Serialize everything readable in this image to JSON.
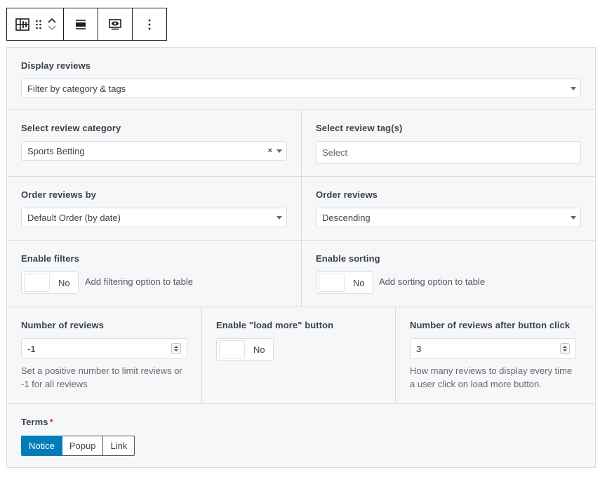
{
  "toolbar": {
    "icons": [
      "table-insert-icon",
      "drag-handle-icon",
      "move-up-icon",
      "move-down-icon",
      "align-icon",
      "preview-eye-icon",
      "more-options-icon"
    ]
  },
  "display_reviews": {
    "label": "Display reviews",
    "value": "Filter by category & tags"
  },
  "review_category": {
    "label": "Select review category",
    "value": "Sports Betting",
    "clear_glyph": "×"
  },
  "review_tags": {
    "label": "Select review tag(s)",
    "placeholder": "Select"
  },
  "order_by": {
    "label": "Order reviews by",
    "value": "Default Order (by date)"
  },
  "order": {
    "label": "Order reviews",
    "value": "Descending"
  },
  "filters": {
    "label": "Enable filters",
    "state": "No",
    "help": "Add filtering option to table"
  },
  "sorting": {
    "label": "Enable sorting",
    "state": "No",
    "help": "Add sorting option to table"
  },
  "num_reviews": {
    "label": "Number of reviews",
    "value": "-1",
    "desc_line1": "Set a positive number to limit reviews or",
    "desc_line2": "-1 for all reviews"
  },
  "load_more": {
    "label": "Enable \"load more\" button",
    "state": "No"
  },
  "num_after_click": {
    "label": "Number of reviews after button click",
    "value": "3",
    "desc_line1": "How many reviews to display every time",
    "desc_line2": "a user click on load more button."
  },
  "terms": {
    "label": "Terms",
    "required_mark": "*",
    "options": [
      "Notice",
      "Popup",
      "Link"
    ],
    "selected": "Notice"
  },
  "colors": {
    "accent": "#007cba",
    "required": "#d63638",
    "panel_bg": "#f6f7f8"
  }
}
